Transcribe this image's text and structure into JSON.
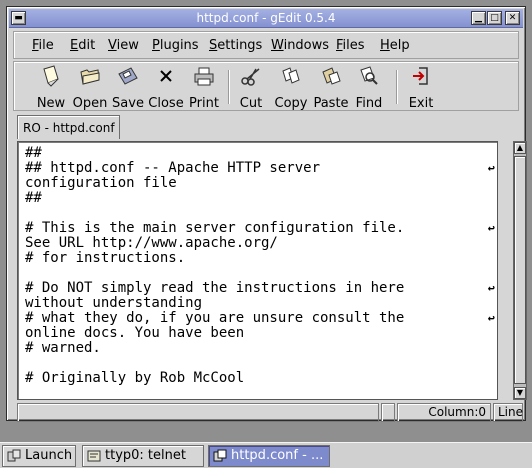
{
  "window": {
    "title": "httpd.conf - gEdit 0.5.4"
  },
  "titlebar": {
    "menu_icon": "window-menu-icon",
    "minimize_icon": "minimize-icon",
    "maximize_icon": "maximize-icon",
    "close_icon": "close-icon"
  },
  "menubar": {
    "items": [
      {
        "label_ul": "F",
        "label_rest": "ile"
      },
      {
        "label_ul": "E",
        "label_rest": "dit"
      },
      {
        "label_ul": "V",
        "label_rest": "iew"
      },
      {
        "label_ul": "P",
        "label_rest": "lugins"
      },
      {
        "label_ul": "S",
        "label_rest": "ettings"
      },
      {
        "label_ul": "W",
        "label_rest": "indows"
      },
      {
        "label_ul": "F",
        "label_rest": "iles"
      },
      {
        "label_ul": "H",
        "label_rest": "elp"
      }
    ]
  },
  "toolbar": {
    "new": "New",
    "open": "Open",
    "save": "Save",
    "close": "Close",
    "print": "Print",
    "cut": "Cut",
    "copy": "Copy",
    "paste": "Paste",
    "find": "Find",
    "exit": "Exit"
  },
  "tab": {
    "label": "RO - httpd.conf"
  },
  "editor": {
    "text": "##\n## httpd.conf -- Apache HTTP server\nconfiguration file\n##\n\n# This is the main server configuration file.\nSee URL http://www.apache.org/\n# for instructions.\n\n# Do NOT simply read the instructions in here\nwithout understanding\n# what they do, if you are unsure consult the\nonline docs. You have been\n# warned.\n\n# Originally by Rob McCool",
    "wrap_marker": "↩"
  },
  "statusbar": {
    "column": "Column:0",
    "line": "Line"
  },
  "taskbar": {
    "launch": "Launch",
    "telnet": "ttyp0: telnet",
    "gedit": "httpd.conf - ..."
  }
}
